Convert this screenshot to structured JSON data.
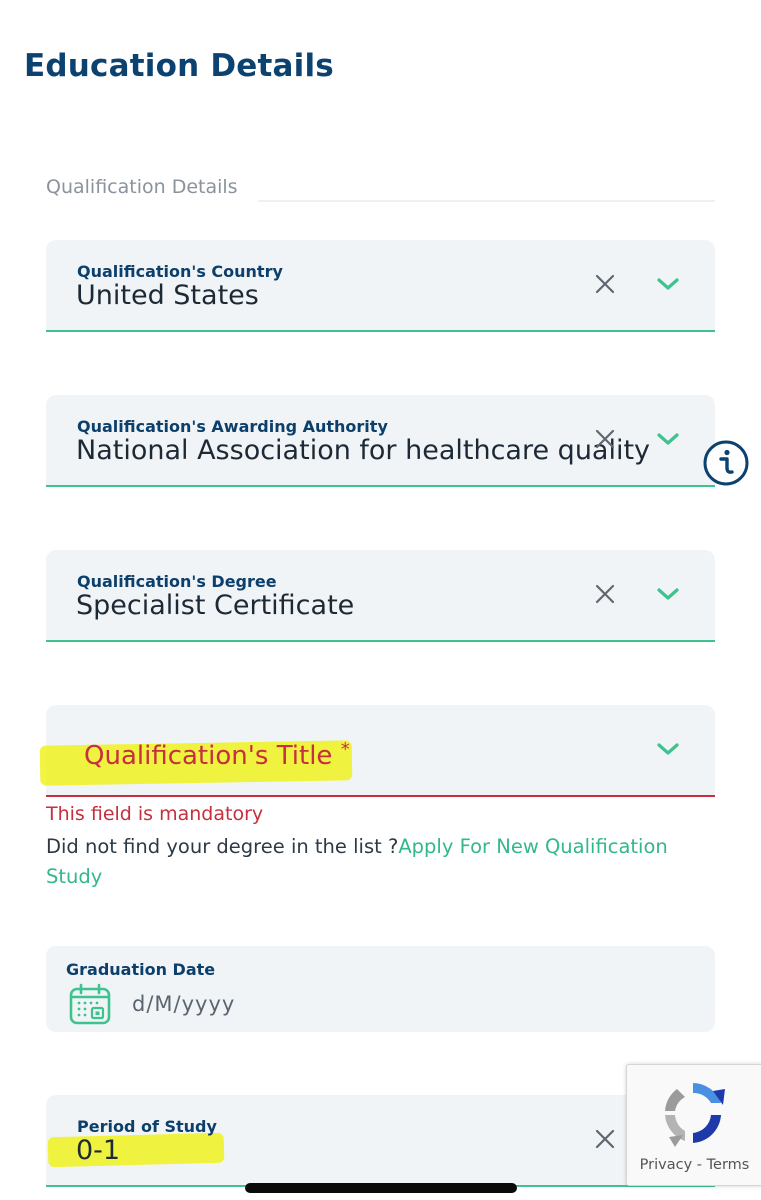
{
  "page": {
    "title": "Education Details"
  },
  "section": {
    "label": "Qualification Details"
  },
  "fields": {
    "country": {
      "label": "Qualification's Country",
      "value": "United States"
    },
    "authority": {
      "label": "Qualification's Awarding Authority",
      "value": "National Association for healthcare quality"
    },
    "degree": {
      "label": "Qualification's Degree",
      "value": "Specialist Certificate"
    },
    "title": {
      "label": "Qualification's Title",
      "required_mark": "*",
      "error": "This field is mandatory"
    },
    "graduation": {
      "label": "Graduation Date",
      "placeholder": "d/M/yyyy"
    },
    "period": {
      "label": "Period of Study",
      "value": "0-1"
    }
  },
  "help": {
    "prefix": "Did not find your degree in the list ?",
    "link": "Apply For New Qualification Study"
  },
  "recaptcha": {
    "privacy": "Privacy",
    "separator": " - ",
    "terms": "Terms"
  },
  "icons": {
    "clear": "close-icon",
    "dropdown": "chevron-down-icon",
    "calendar": "calendar-icon",
    "info": "info-icon"
  },
  "colors": {
    "primary": "#0c426f",
    "accent": "#3ec38e",
    "error": "#c62f3e",
    "highlight": "#eef21e"
  }
}
